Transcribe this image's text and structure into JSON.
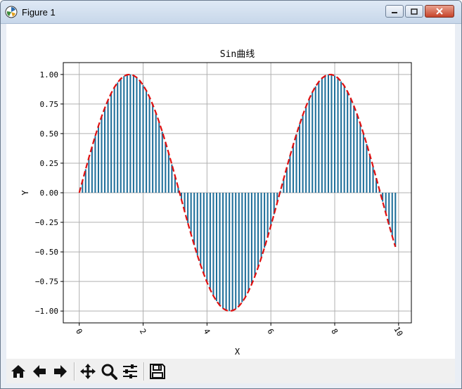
{
  "window": {
    "title": "Figure 1"
  },
  "toolbar": {
    "buttons": [
      {
        "name": "home-icon"
      },
      {
        "name": "back-icon"
      },
      {
        "name": "forward-icon"
      },
      {
        "name": "pan-icon"
      },
      {
        "name": "zoom-icon"
      },
      {
        "name": "configure-subplots-icon"
      },
      {
        "name": "save-icon"
      }
    ]
  },
  "chart_data": {
    "type": "bar",
    "title": "Sin曲线",
    "xlabel": "X",
    "ylabel": "Y",
    "xlim": [
      -0.5,
      10.4
    ],
    "ylim": [
      -1.1,
      1.1
    ],
    "x_ticks": [
      0,
      2,
      4,
      6,
      8,
      10
    ],
    "y_ticks": [
      -1.0,
      -0.75,
      -0.5,
      -0.25,
      0.0,
      0.25,
      0.5,
      0.75,
      1.0
    ],
    "x_tick_labels": [
      "0",
      "2",
      "4",
      "6",
      "8",
      "10"
    ],
    "y_tick_labels": [
      "−1.00",
      "−0.75",
      "−0.50",
      "−0.25",
      "0.00",
      "0.25",
      "0.50",
      "0.75",
      "1.00"
    ],
    "x_tick_rotation_deg": -60,
    "grid": true,
    "bar_color": "#1f6f9a",
    "line_color": "#e01010",
    "series": [
      {
        "style": "bar",
        "x_start": 0.0,
        "x_step": 0.1,
        "count": 100,
        "function": "sin(x)"
      },
      {
        "style": "dashed-line",
        "x_start": 0.0,
        "x_step": 0.1,
        "count": 100,
        "function": "sin(x)"
      }
    ]
  }
}
